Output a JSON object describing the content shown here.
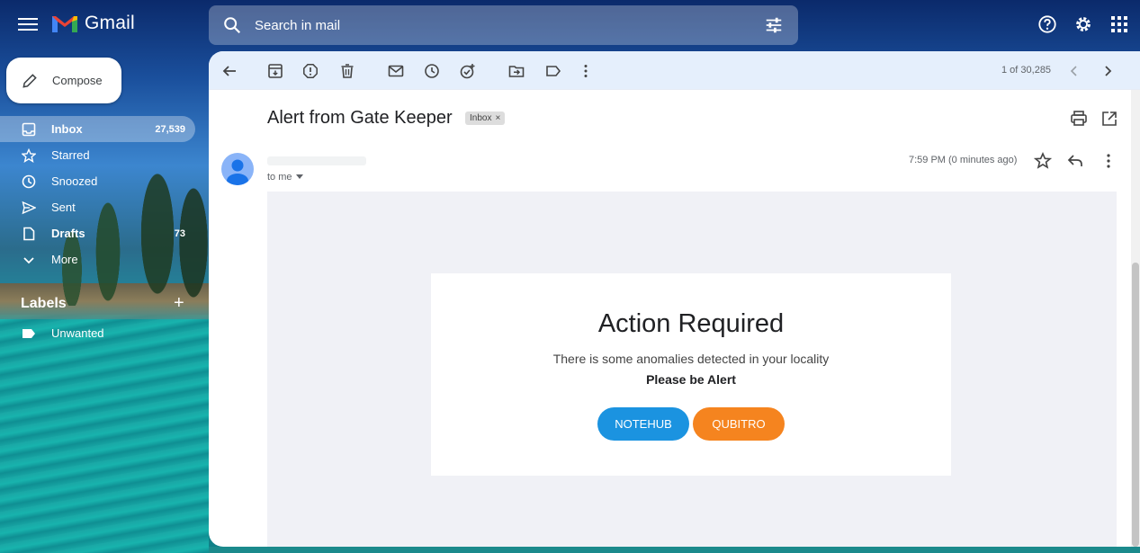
{
  "app": {
    "name": "Gmail"
  },
  "search": {
    "placeholder": "Search in mail"
  },
  "sidebar": {
    "compose_label": "Compose",
    "items": [
      {
        "label": "Inbox",
        "count": "27,539"
      },
      {
        "label": "Starred",
        "count": ""
      },
      {
        "label": "Snoozed",
        "count": ""
      },
      {
        "label": "Sent",
        "count": ""
      },
      {
        "label": "Drafts",
        "count": "73"
      },
      {
        "label": "More",
        "count": ""
      }
    ],
    "labels_heading": "Labels",
    "labels": [
      {
        "label": "Unwanted"
      }
    ]
  },
  "toolbar": {
    "pager": "1 of 30,285"
  },
  "email": {
    "subject": "Alert from Gate Keeper",
    "chip": "Inbox",
    "recipient": "to me",
    "timestamp": "7:59 PM (0 minutes ago)",
    "body": {
      "title": "Action Required",
      "line1": "There is some anomalies detected in your locality",
      "line2": "Please be Alert",
      "buttons": [
        {
          "label": "NOTEHUB",
          "color": "#1b93e0"
        },
        {
          "label": "QUBITRO",
          "color": "#f5841f"
        }
      ]
    }
  }
}
